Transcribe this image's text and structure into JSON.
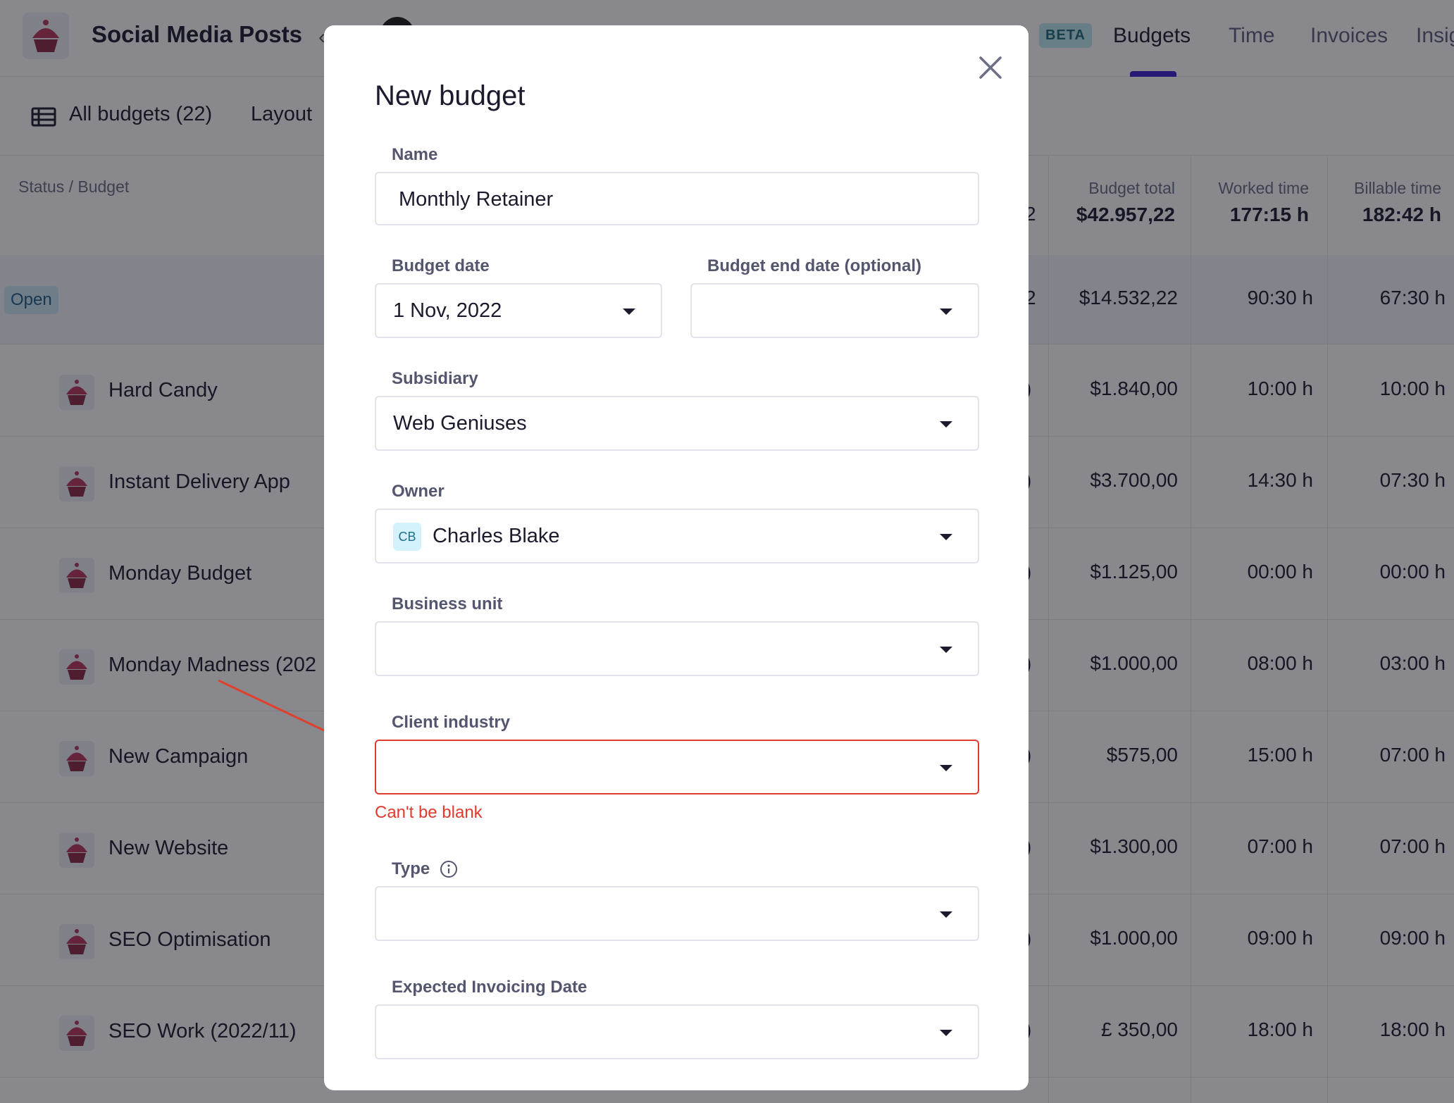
{
  "app": {
    "title": "Social Media Posts",
    "beta": "BETA",
    "tabs": [
      {
        "label": "Budgets"
      },
      {
        "label": "Time"
      },
      {
        "label": "Invoices"
      },
      {
        "label": "Insig"
      }
    ]
  },
  "toolbar": {
    "all_budgets": "All budgets (22)",
    "layout": "Layout"
  },
  "table": {
    "status_header": "Status / Budget",
    "columns": [
      {
        "label": "Budget total",
        "total": "$42.957,22"
      },
      {
        "label": "Worked time",
        "total": "177:15 h"
      },
      {
        "label": "Billable time",
        "total": "182:42 h"
      }
    ],
    "group": {
      "badge": "Open",
      "partial": "2",
      "budget_total": "$14.532,22",
      "worked": "90:30 h",
      "billable": "67:30 h"
    },
    "rows": [
      {
        "name": "Hard Candy",
        "partial": ")",
        "budget_total": "$1.840,00",
        "worked": "10:00 h",
        "billable": "10:00 h"
      },
      {
        "name": "Instant Delivery App",
        "partial": ")",
        "budget_total": "$3.700,00",
        "worked": "14:30 h",
        "billable": "07:30 h"
      },
      {
        "name": "Monday Budget",
        "partial": ")",
        "budget_total": "$1.125,00",
        "worked": "00:00 h",
        "billable": "00:00 h"
      },
      {
        "name": "Monday Madness (202",
        "partial": ")",
        "budget_total": "$1.000,00",
        "worked": "08:00 h",
        "billable": "03:00 h"
      },
      {
        "name": "New Campaign",
        "partial": ")",
        "budget_total": "$575,00",
        "worked": "15:00 h",
        "billable": "07:00 h"
      },
      {
        "name": "New Website",
        "partial": ")",
        "budget_total": "$1.300,00",
        "worked": "07:00 h",
        "billable": "07:00 h"
      },
      {
        "name": "SEO Optimisation",
        "partial": ")",
        "budget_total": "$1.000,00",
        "worked": "09:00 h",
        "billable": "09:00 h"
      },
      {
        "name": "SEO Work (2022/11)",
        "partial": ")",
        "budget_total": "£ 350,00",
        "worked": "18:00 h",
        "billable": "18:00 h"
      }
    ]
  },
  "modal": {
    "title": "New budget",
    "fields": {
      "name": {
        "label": "Name",
        "value": "Monthly Retainer"
      },
      "budget_date": {
        "label": "Budget date",
        "value": "1 Nov, 2022"
      },
      "budget_end_date": {
        "label": "Budget end date (optional)",
        "value": ""
      },
      "subsidiary": {
        "label": "Subsidiary",
        "value": "Web Geniuses"
      },
      "owner": {
        "label": "Owner",
        "value": "Charles Blake",
        "initials": "CB"
      },
      "business_unit": {
        "label": "Business unit",
        "value": ""
      },
      "client_industry": {
        "label": "Client industry",
        "value": "",
        "error": "Can't be blank"
      },
      "type": {
        "label": "Type",
        "value": ""
      },
      "expected_invoicing_date": {
        "label": "Expected Invoicing Date",
        "value": ""
      }
    }
  },
  "colors": {
    "accent": "#3b1fcf",
    "error": "#e23a2e",
    "overlay": "rgba(18,18,28,0.5)",
    "annotation_arrow": "#e0402c"
  }
}
